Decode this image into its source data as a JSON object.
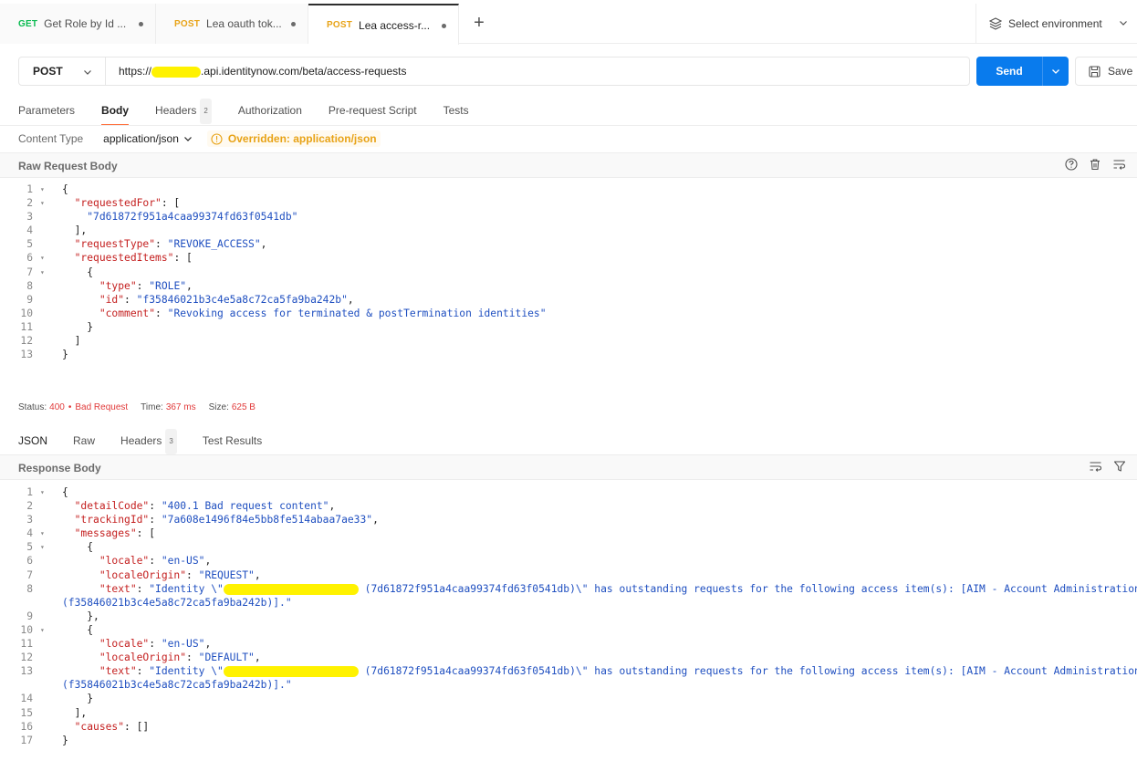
{
  "tabs": [
    {
      "method": "GET",
      "name": "Get Role by Id ...",
      "color": "#0cbb52"
    },
    {
      "method": "POST",
      "name": "Lea oauth tok...",
      "color": "#e8a317"
    },
    {
      "method": "POST",
      "name": "Lea access-r...",
      "color": "#e8a317"
    }
  ],
  "add_tab_label": "+",
  "environment": {
    "label": "Select environment",
    "icon": "layers-icon"
  },
  "request": {
    "method": "POST",
    "url_prefix": "https://",
    "url_suffix": ".api.identitynow.com/beta/access-requests",
    "send_label": "Send",
    "save_label": "Save"
  },
  "request_tabs": [
    {
      "label": "Parameters"
    },
    {
      "label": "Body",
      "active": true
    },
    {
      "label": "Headers",
      "badge": "2"
    },
    {
      "label": "Authorization"
    },
    {
      "label": "Pre-request Script"
    },
    {
      "label": "Tests"
    }
  ],
  "content_type": {
    "label": "Content Type",
    "value": "application/json",
    "override": "Overridden: application/json"
  },
  "request_body_title": "Raw Request Body",
  "request_body": [
    {
      "n": "1",
      "fold": true,
      "html": "{"
    },
    {
      "n": "2",
      "fold": true,
      "html": "  <span class='k'>\"requestedFor\"</span>: ["
    },
    {
      "n": "3",
      "html": "    <span class='s'>\"7d61872f951a4caa99374fd63f0541db\"</span>"
    },
    {
      "n": "4",
      "html": "  ],"
    },
    {
      "n": "5",
      "html": "  <span class='k'>\"requestType\"</span>: <span class='s'>\"REVOKE_ACCESS\"</span>,"
    },
    {
      "n": "6",
      "fold": true,
      "html": "  <span class='k'>\"requestedItems\"</span>: ["
    },
    {
      "n": "7",
      "fold": true,
      "html": "    {"
    },
    {
      "n": "8",
      "html": "      <span class='k'>\"type\"</span>: <span class='s'>\"ROLE\"</span>,"
    },
    {
      "n": "9",
      "html": "      <span class='k'>\"id\"</span>: <span class='s'>\"f35846021b3c4e5a8c72ca5fa9ba242b\"</span>,"
    },
    {
      "n": "10",
      "html": "      <span class='k'>\"comment\"</span>: <span class='s'>\"Revoking access for terminated &amp; postTermination identities\"</span>"
    },
    {
      "n": "11",
      "html": "    }"
    },
    {
      "n": "12",
      "html": "  ]"
    },
    {
      "n": "13",
      "html": "}"
    }
  ],
  "status": {
    "label": "Status:",
    "code": "400",
    "text": "Bad Request",
    "time_label": "Time:",
    "time": "367 ms",
    "size_label": "Size:",
    "size": "625 B"
  },
  "response_tabs": [
    {
      "label": "JSON",
      "active": true
    },
    {
      "label": "Raw"
    },
    {
      "label": "Headers",
      "badge": "3"
    },
    {
      "label": "Test Results"
    }
  ],
  "response_body_title": "Response Body",
  "response_body": [
    {
      "n": "1",
      "fold": true,
      "html": "{"
    },
    {
      "n": "2",
      "html": "  <span class='k'>\"detailCode\"</span>: <span class='s'>\"400.1 Bad request content\"</span>,"
    },
    {
      "n": "3",
      "html": "  <span class='k'>\"trackingId\"</span>: <span class='s'>\"7a608e1496f84e5bb8fe514abaa7ae33\"</span>,"
    },
    {
      "n": "4",
      "fold": true,
      "html": "  <span class='k'>\"messages\"</span>: ["
    },
    {
      "n": "5",
      "fold": true,
      "html": "    {"
    },
    {
      "n": "6",
      "html": "      <span class='k'>\"locale\"</span>: <span class='s'>\"en-US\"</span>,"
    },
    {
      "n": "7",
      "html": "      <span class='k'>\"localeOrigin\"</span>: <span class='s'>\"REQUEST\"</span>,"
    },
    {
      "n": "8",
      "html": "      <span class='k'>\"text\"</span>: <span class='s'>\"Identity \\\"<span class='redact' style='width:148px'></span> (7d61872f951a4caa99374fd63f0541db)\\\" has outstanding requests for the following access item(s): [AIM - Account Administration User</span>"
    },
    {
      "n": "",
      "wrap": true,
      "html": "(f35846021b3c4e5a8c72ca5fa9ba242b)].\""
    },
    {
      "n": "9",
      "html": "    },"
    },
    {
      "n": "10",
      "fold": true,
      "html": "    {"
    },
    {
      "n": "11",
      "html": "      <span class='k'>\"locale\"</span>: <span class='s'>\"en-US\"</span>,"
    },
    {
      "n": "12",
      "html": "      <span class='k'>\"localeOrigin\"</span>: <span class='s'>\"DEFAULT\"</span>,"
    },
    {
      "n": "13",
      "html": "      <span class='k'>\"text\"</span>: <span class='s'>\"Identity \\\"<span class='redact' style='width:148px'></span> (7d61872f951a4caa99374fd63f0541db)\\\" has outstanding requests for the following access item(s): [AIM - Account Administration User</span>"
    },
    {
      "n": "",
      "wrap": true,
      "html": "(f35846021b3c4e5a8c72ca5fa9ba242b)].\""
    },
    {
      "n": "14",
      "html": "    }"
    },
    {
      "n": "15",
      "html": "  ],"
    },
    {
      "n": "16",
      "html": "  <span class='k'>\"causes\"</span>: []"
    },
    {
      "n": "17",
      "html": "}"
    }
  ]
}
